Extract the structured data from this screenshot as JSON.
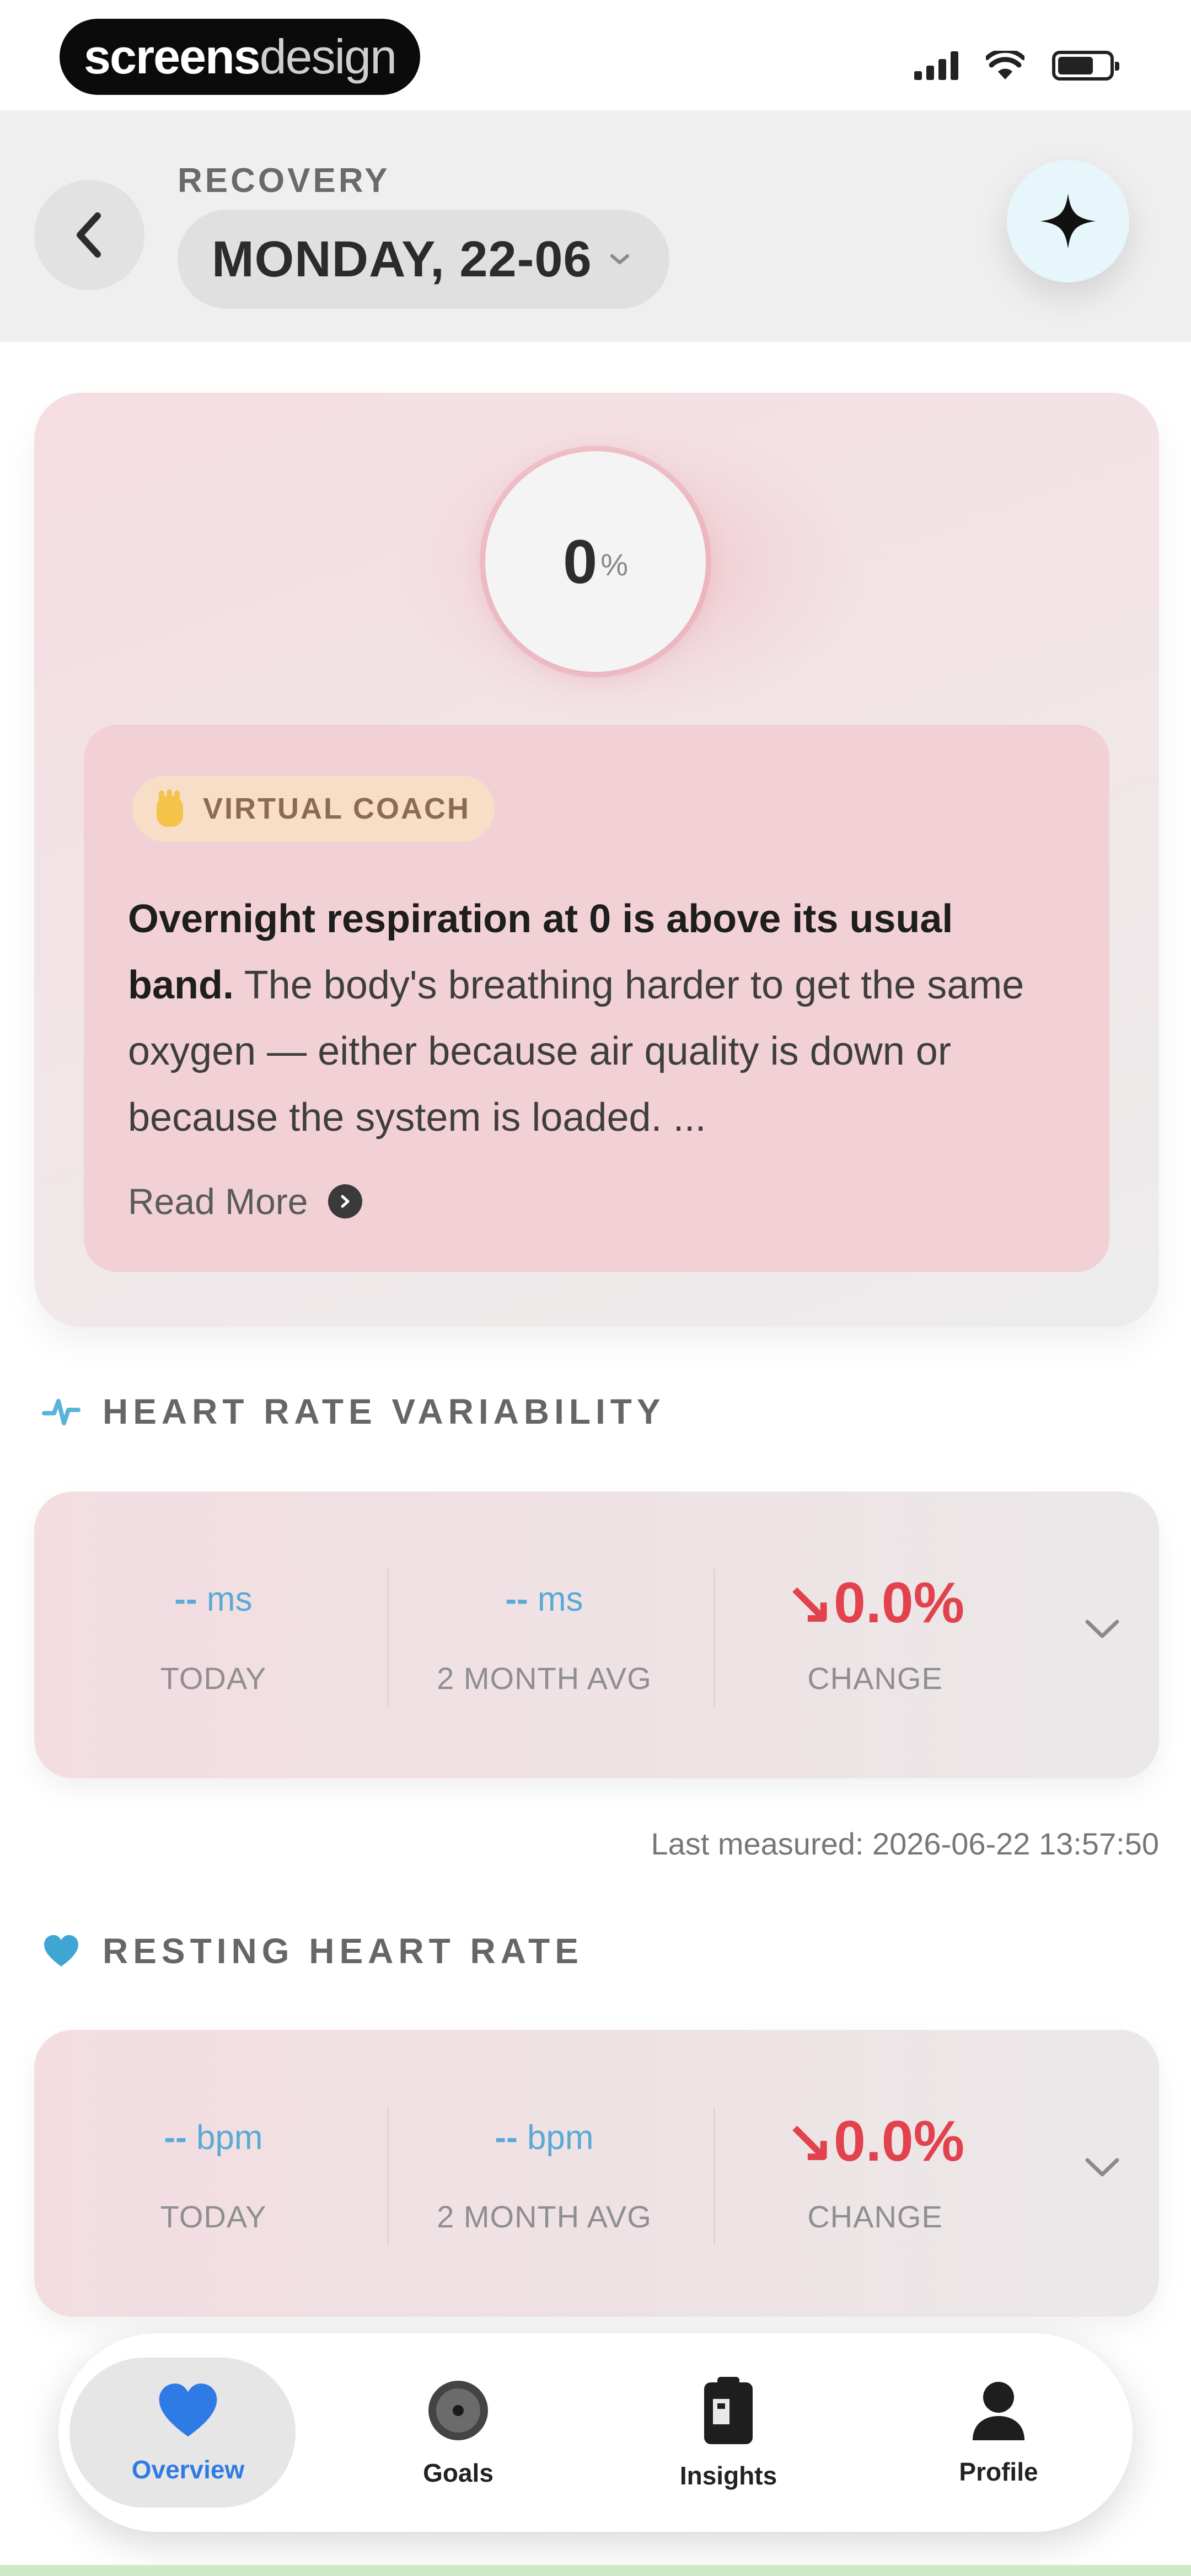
{
  "status_bar": {
    "watermark_bold": "screens",
    "watermark_light": "design"
  },
  "header": {
    "section_label": "RECOVERY",
    "date": "MONDAY, 22-06"
  },
  "score": {
    "value": "0",
    "unit": "%"
  },
  "coach": {
    "badge": "VIRTUAL COACH",
    "lead": "Overnight respiration at 0 is above its usual band.",
    "body": " The body's breathing harder to get the same oxygen — either because air quality is down or because the system is loaded. ...",
    "read_more": "Read More"
  },
  "hrv": {
    "title": "HEART RATE VARIABILITY",
    "today_value": "--",
    "today_unit": " ms",
    "today_label": "TODAY",
    "avg_value": "--",
    "avg_unit": " ms",
    "avg_label": "2 MONTH AVG",
    "change_value": "↘0.0%",
    "change_label": "CHANGE",
    "last_measured": "Last measured: 2026-06-22 13:57:50"
  },
  "rhr": {
    "title": "RESTING HEART RATE",
    "today_value": "--",
    "today_unit": " bpm",
    "today_label": "TODAY",
    "avg_value": "--",
    "avg_unit": " bpm",
    "avg_label": "2 MONTH AVG",
    "change_value": "↘0.0%",
    "change_label": "CHANGE"
  },
  "nav": {
    "items": [
      {
        "label": "Overview",
        "icon": "heart-icon"
      },
      {
        "label": "Goals",
        "icon": "target-icon"
      },
      {
        "label": "Insights",
        "icon": "clipboard-icon"
      },
      {
        "label": "Profile",
        "icon": "person-icon"
      }
    ]
  },
  "colors": {
    "accent_blue": "#2f7be6",
    "change_red": "#e2424d",
    "metric_blue": "#5aa9d6"
  }
}
